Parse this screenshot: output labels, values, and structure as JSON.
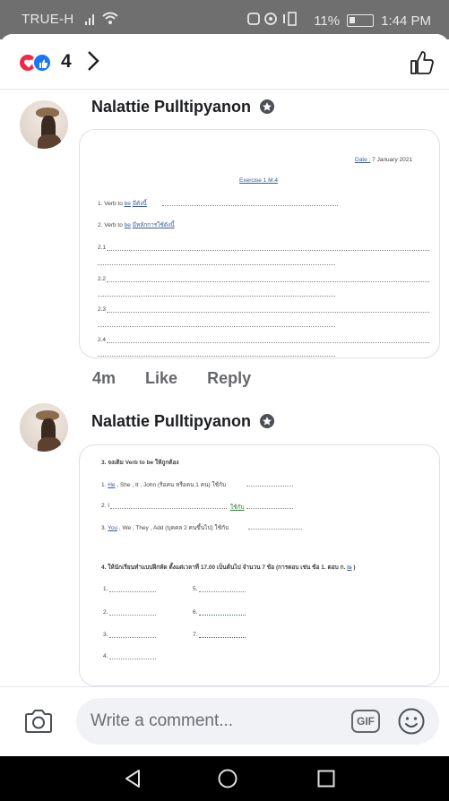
{
  "status_bar": {
    "carrier": "TRUE-H",
    "battery": "11%",
    "time": "1:44 PM"
  },
  "reactions": {
    "count": "4",
    "colors": {
      "heart": "#f0284a",
      "like": "#1877f2"
    }
  },
  "comments": [
    {
      "author": "Nalattie Pulltipyanon",
      "time": "4m",
      "like_label": "Like",
      "reply_label": "Reply",
      "document": {
        "date_label": "Date :",
        "date_value": "7 January  2021",
        "heading": "Exercise 1  M.4",
        "item1_prefix": "1. Verb to ",
        "item1_be": "be",
        "item1_suffix": "มีดังนี้",
        "item2_prefix": "2. Verb to ",
        "item2_be": "be",
        "item2_suffix": "มีหลักการใช้ดังนี้",
        "sub1": "2.1",
        "sub2": "2.2",
        "sub3": "2.3",
        "sub4": "2.4"
      }
    },
    {
      "author": "Nalattie Pulltipyanon",
      "document": {
        "q3_title": "3. จงเติม Verb to be ให้ถูกต้อง",
        "q3_l1_a": "1. ",
        "q3_l1_he": "He",
        "q3_l1_b": " , She , It , John (ร้อคน หรือคน 1 คน) ใช้กับ",
        "q3_l2_a": "2. I",
        "q3_l2_b": "ใช้กับ",
        "q3_l3_a": "3. ",
        "q3_l3_you": "You",
        "q3_l3_b": " , We , They , Add (บุคคล 2 คนขึ้นไป) ใช้กับ",
        "q4_title": "4. ให้นักเรียนทำแบบฝึกหัด ตั้งแต่เวลาที่ 17.00 เป็นต้นไป จำนวน 7 ข้อ  (การตอบ เช่น ข้อ 1. ตอบ ก. ",
        "q4_example": "is",
        "q4_close": " )",
        "n1": "1.",
        "n2": "2.",
        "n3": "3.",
        "n4": "4.",
        "n5": "5.",
        "n6": "6.",
        "n7": "7."
      }
    }
  ],
  "composer": {
    "placeholder": "Write a comment...",
    "gif_label": "GIF"
  }
}
